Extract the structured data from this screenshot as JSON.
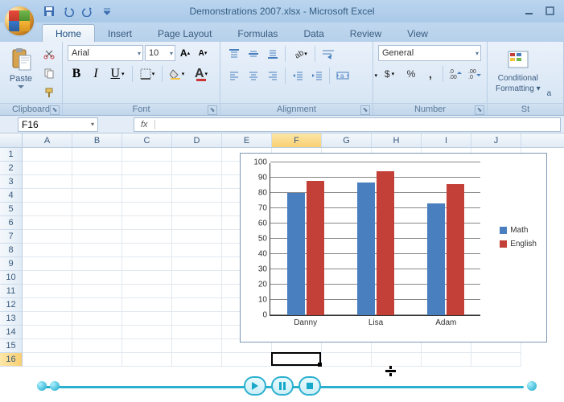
{
  "window": {
    "title": "Demonstrations 2007.xlsx - Microsoft Excel"
  },
  "tabs": {
    "items": [
      "Home",
      "Insert",
      "Page Layout",
      "Formulas",
      "Data",
      "Review",
      "View"
    ],
    "active": 0
  },
  "ribbon": {
    "clipboard": {
      "label": "Clipboard",
      "paste": "Paste"
    },
    "font": {
      "label": "Font",
      "name": "Arial",
      "size": "10",
      "bold": "B",
      "italic": "I",
      "underline": "U"
    },
    "alignment": {
      "label": "Alignment"
    },
    "number": {
      "label": "Number",
      "format": "General"
    },
    "styles": {
      "label": "St",
      "conditional": "Conditional",
      "conditional2": "Formatting",
      "arrow": "a"
    }
  },
  "formula_bar": {
    "cell_ref": "F16",
    "fx": "fx",
    "content": ""
  },
  "columns": [
    "A",
    "B",
    "C",
    "D",
    "E",
    "F",
    "G",
    "H",
    "I",
    "J"
  ],
  "row_count": 16,
  "active": {
    "col_index": 5,
    "row": 16
  },
  "chart_data": {
    "type": "bar",
    "categories": [
      "Danny",
      "Lisa",
      "Adam"
    ],
    "series": [
      {
        "name": "Math",
        "values": [
          80,
          87,
          73
        ],
        "color": "#4a7fbf"
      },
      {
        "name": "English",
        "values": [
          88,
          94,
          86
        ],
        "color": "#c34038"
      }
    ],
    "ylim": [
      0,
      100
    ],
    "ystep": 10
  },
  "legend": {
    "math": "Math",
    "english": "English"
  }
}
